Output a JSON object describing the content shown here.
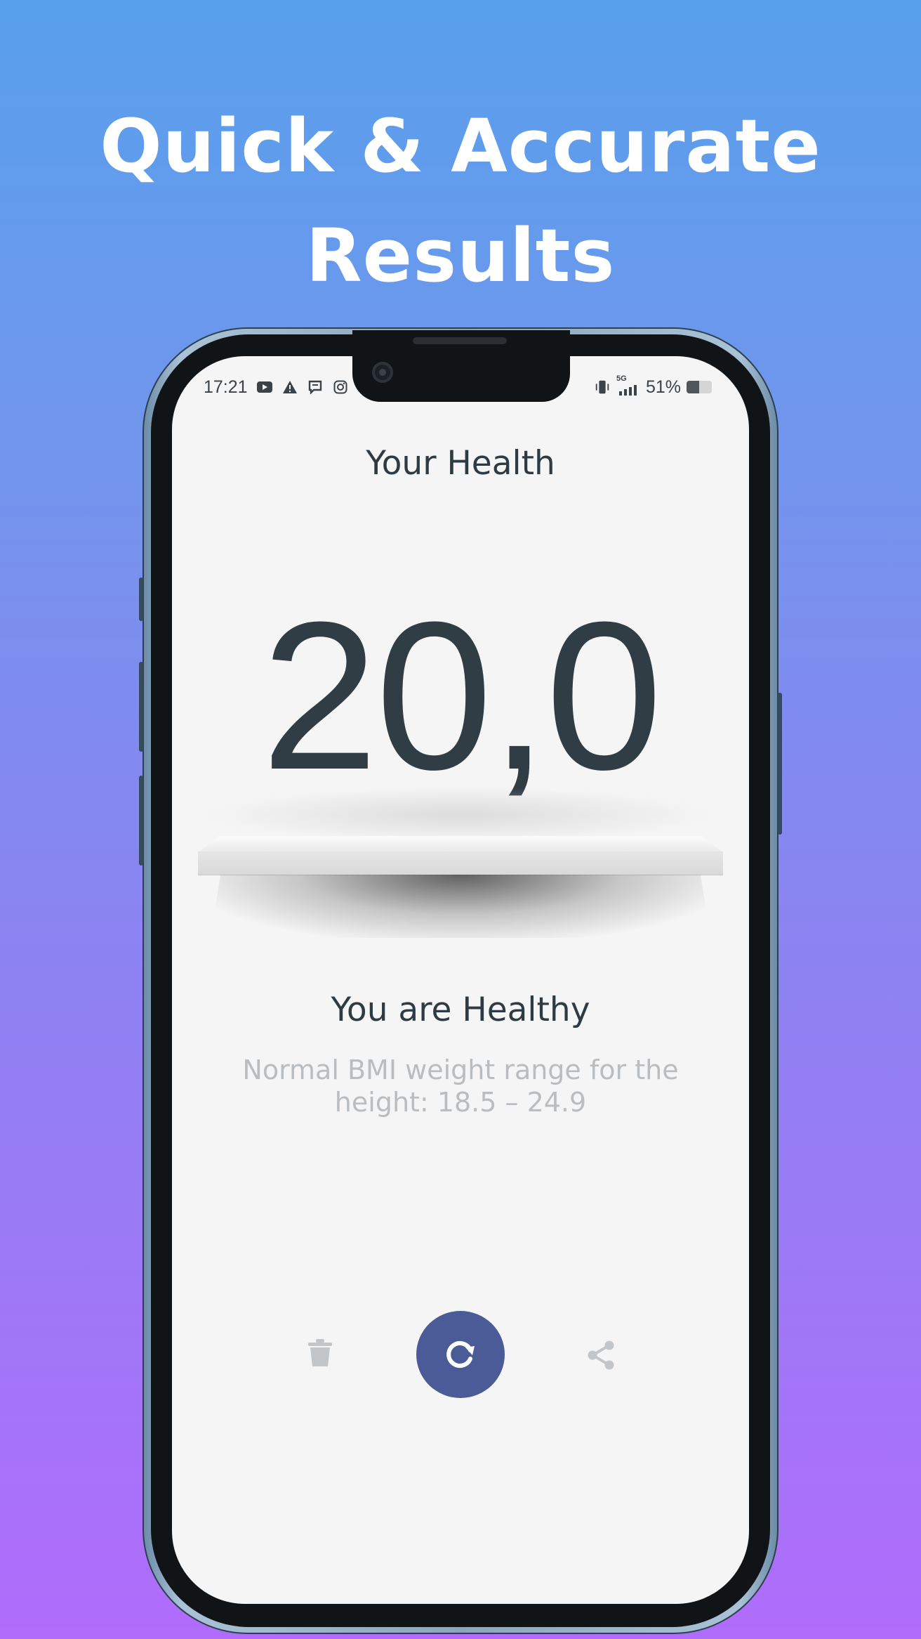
{
  "promo": {
    "line1": "Quick & Accurate",
    "line2": "Results"
  },
  "status_bar": {
    "time": "17:21",
    "network": "5G",
    "battery": "51%",
    "battery_level": 0.51,
    "left_icons": [
      "youtube-icon",
      "warning-icon",
      "message-icon",
      "instagram-icon"
    ],
    "right_icons": [
      "vibrate-icon",
      "signal-icon",
      "battery-icon"
    ]
  },
  "screen": {
    "title": "Your Health",
    "bmi_value": "20,0",
    "status_title": "You are Healthy",
    "range_text": "Normal BMI weight range for the height: 18.5 – 24.9"
  },
  "actions": {
    "delete_icon": "trash-icon",
    "recalculate_icon": "refresh-icon",
    "share_icon": "share-icon"
  },
  "colors": {
    "background_top": "#58a0ec",
    "background_bottom": "#b06cfb",
    "primary_button": "#4a5b98",
    "text_dark": "#303d45",
    "text_muted": "#b9bdc0",
    "screen_bg": "#f5f5f6"
  }
}
